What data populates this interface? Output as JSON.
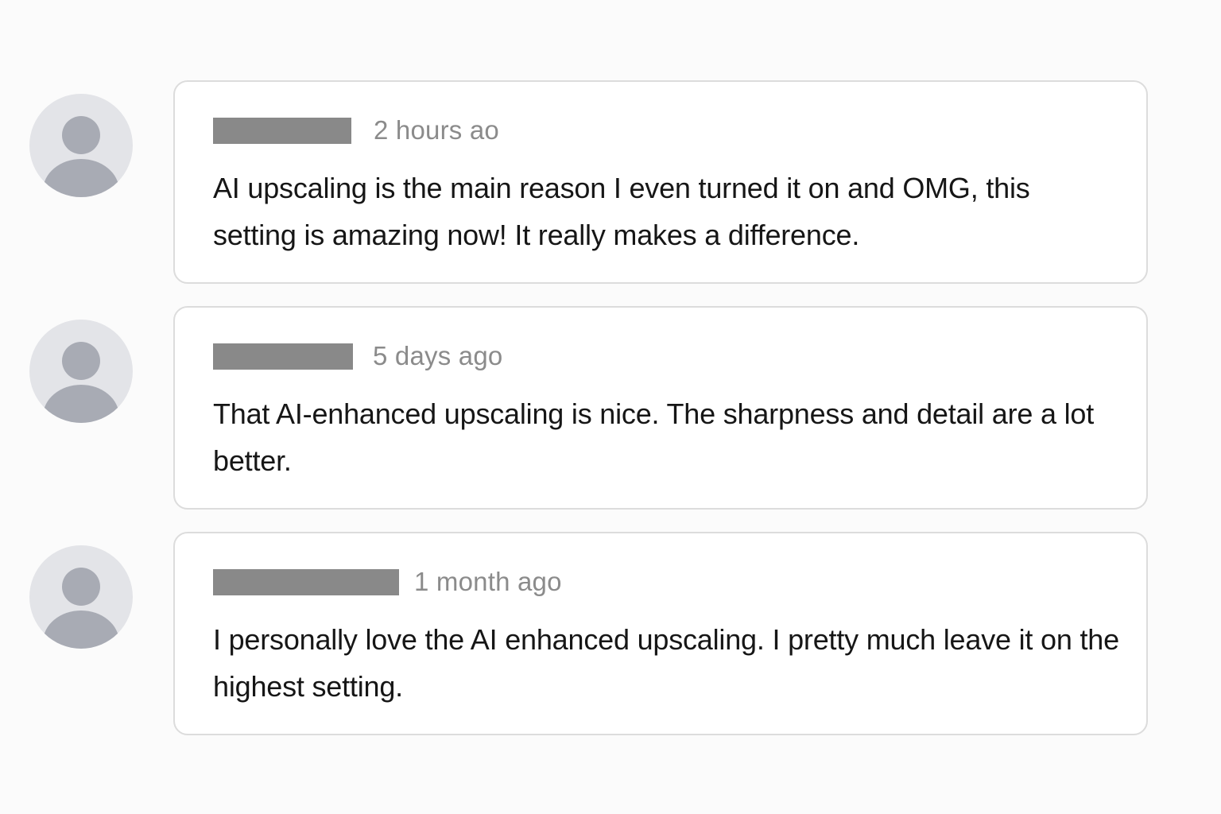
{
  "comments": [
    {
      "avatar_icon": "default-user-avatar-icon",
      "username": "",
      "timestamp": "2 hours ao",
      "text": "AI upscaling is the main reason I even turned it on and OMG, this setting is amazing now! It really makes a difference."
    },
    {
      "avatar_icon": "default-user-avatar-icon",
      "username": "",
      "timestamp": "5 days ago",
      "text": "That AI-enhanced upscaling is nice. The sharpness and detail are a lot better."
    },
    {
      "avatar_icon": "default-user-avatar-icon",
      "username": "",
      "timestamp": "1 month ago",
      "text": "I personally love the AI enhanced upscaling. I pretty much leave it on the highest setting."
    }
  ],
  "colors": {
    "page_background": "#fbfbfb",
    "card_background": "#ffffff",
    "card_border": "#dcdcdc",
    "avatar_background": "#e3e4e8",
    "avatar_silhouette": "#a8abb4",
    "redaction_bar": "#898989",
    "timestamp_text": "#8b8b8b",
    "body_text": "#161616"
  }
}
